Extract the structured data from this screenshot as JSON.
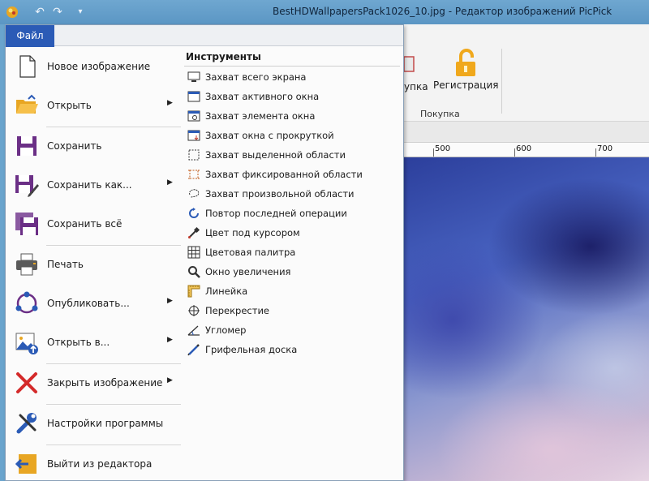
{
  "window": {
    "title": "BestHDWallpapersPack1026_10.jpg - Редактор изображений PicPick"
  },
  "quick_access": {
    "undo_icon": "undo-icon",
    "redo_icon": "redo-icon",
    "customize_icon": "customize-icon"
  },
  "ribbon": {
    "buy_partial": "упка",
    "register_label": "Регистрация",
    "group_label": "Покупка"
  },
  "ruler": {
    "labels": [
      "500",
      "600",
      "700"
    ]
  },
  "menu": {
    "file_tab": "Файл",
    "items": [
      {
        "label": "Новое изображение",
        "icon": "new-image-icon",
        "submenu": false
      },
      {
        "label": "Открыть",
        "icon": "open-folder-icon",
        "submenu": true
      },
      {
        "label": "Сохранить",
        "icon": "save-icon",
        "submenu": false
      },
      {
        "label": "Сохранить как...",
        "icon": "save-as-icon",
        "submenu": true
      },
      {
        "label": "Сохранить всё",
        "icon": "save-all-icon",
        "submenu": false
      },
      {
        "label": "Печать",
        "icon": "print-icon",
        "submenu": false
      },
      {
        "label": "Опубликовать...",
        "icon": "share-icon",
        "submenu": true
      },
      {
        "label": "Открыть в...",
        "icon": "open-in-icon",
        "submenu": true
      },
      {
        "label": "Закрыть изображение",
        "icon": "close-image-icon",
        "submenu": true
      },
      {
        "label": "Настройки программы",
        "icon": "settings-icon",
        "submenu": false
      },
      {
        "label": "Выйти из редактора",
        "icon": "exit-icon",
        "submenu": false
      }
    ],
    "tools_header": "Инструменты",
    "tools": [
      {
        "label": "Захват всего экрана",
        "icon": "fullscreen-capture-icon"
      },
      {
        "label": "Захват активного окна",
        "icon": "active-window-capture-icon"
      },
      {
        "label": "Захват элемента окна",
        "icon": "window-control-capture-icon"
      },
      {
        "label": "Захват окна с прокруткой",
        "icon": "scrolling-capture-icon"
      },
      {
        "label": "Захват выделенной области",
        "icon": "region-capture-icon"
      },
      {
        "label": "Захват фиксированной области",
        "icon": "fixed-region-capture-icon"
      },
      {
        "label": "Захват произвольной области",
        "icon": "freehand-capture-icon"
      },
      {
        "label": "Повтор последней операции",
        "icon": "repeat-last-capture-icon"
      },
      {
        "label": "Цвет под курсором",
        "icon": "color-picker-icon"
      },
      {
        "label": "Цветовая палитра",
        "icon": "color-palette-icon"
      },
      {
        "label": "Окно увеличения",
        "icon": "magnifier-icon"
      },
      {
        "label": "Линейка",
        "icon": "ruler-icon"
      },
      {
        "label": "Перекрестие",
        "icon": "crosshair-icon"
      },
      {
        "label": "Угломер",
        "icon": "protractor-icon"
      },
      {
        "label": "Грифельная доска",
        "icon": "whiteboard-icon"
      }
    ]
  },
  "colors": {
    "menu_tab": "#2b5bb6",
    "accent_purple": "#6b2f86",
    "title_bar": "#5b96c4"
  }
}
